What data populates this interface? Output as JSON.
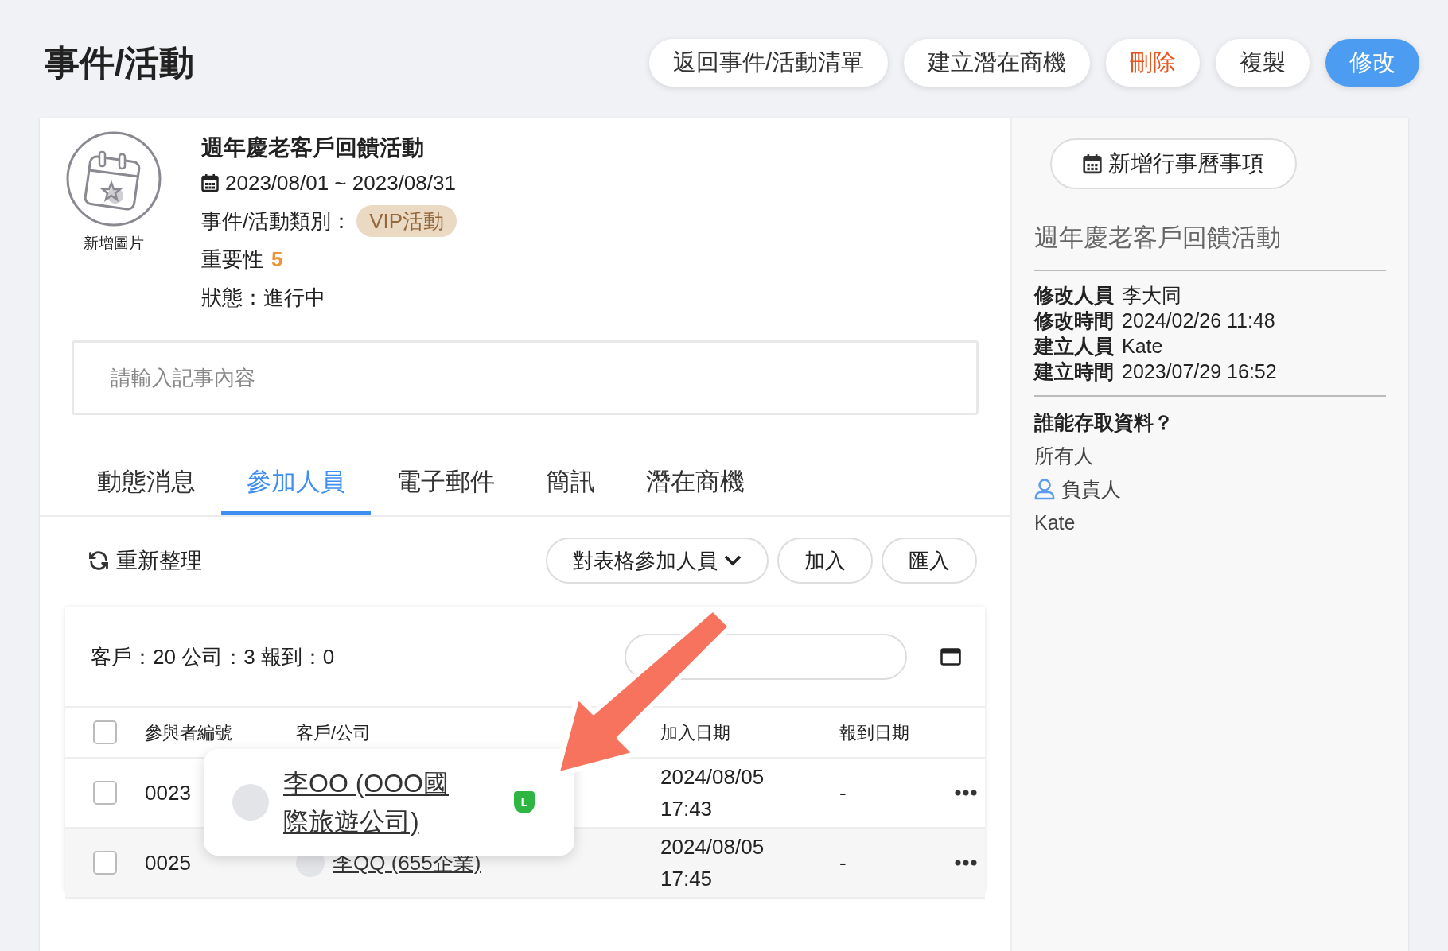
{
  "page_title": "事件/活動",
  "header_buttons": [
    {
      "label": "返回事件/活動清單",
      "kind": "default"
    },
    {
      "label": "建立潛在商機",
      "kind": "default"
    },
    {
      "label": "刪除",
      "kind": "danger"
    },
    {
      "label": "複製",
      "kind": "default"
    },
    {
      "label": "修改",
      "kind": "primary"
    }
  ],
  "event": {
    "image_label": "新增圖片",
    "title": "週年慶老客戶回饋活動",
    "date_range": "2023/08/01 ~ 2023/08/31",
    "category_label": "事件/活動類別：",
    "category": "VIP活動",
    "importance_label": "重要性",
    "importance": "5",
    "status": "狀態：進行中"
  },
  "note": {
    "placeholder": "請輸入記事內容"
  },
  "tabs": [
    {
      "label": "動態消息",
      "selected": false
    },
    {
      "label": "參加人員",
      "selected": true
    },
    {
      "label": "電子郵件",
      "selected": false
    },
    {
      "label": "簡訊",
      "selected": false
    },
    {
      "label": "潛在商機",
      "selected": false
    }
  ],
  "toolbar": {
    "refresh": "重新整理",
    "dropdown": "對表格參加人員",
    "buttons": [
      "加入",
      "匯入"
    ]
  },
  "table": {
    "summary": "客戶：20 公司：3 報到：0",
    "all_checked": false,
    "columns": [
      "參與者編號",
      "客戶/公司",
      "加入日期",
      "報到日期"
    ],
    "rows": [
      {
        "id": "0023",
        "customer": "",
        "join_date": "2024/08/05 17:43",
        "checkin_date": "-",
        "checked": false
      },
      {
        "id": "0025",
        "customer": "李QQ (655企業)",
        "join_date": "2024/08/05 17:45",
        "checkin_date": "-",
        "checked": false
      }
    ]
  },
  "popup": {
    "customer": "李OO (OOO國際旅遊公司)",
    "badge": "L"
  },
  "side": {
    "calendar_button": "新增行事曆事項",
    "title": "週年慶老客戶回饋活動",
    "info": [
      {
        "label": "修改人員",
        "value": "李大同"
      },
      {
        "label": "修改時間",
        "value": "2024/02/26 11:48"
      },
      {
        "label": "建立人員",
        "value": "Kate"
      },
      {
        "label": "建立時間",
        "value": "2023/07/29 16:52"
      }
    ],
    "access_title": "誰能存取資料？",
    "access_everyone": "所有人",
    "owner_label": "負責人",
    "owner": "Kate"
  }
}
